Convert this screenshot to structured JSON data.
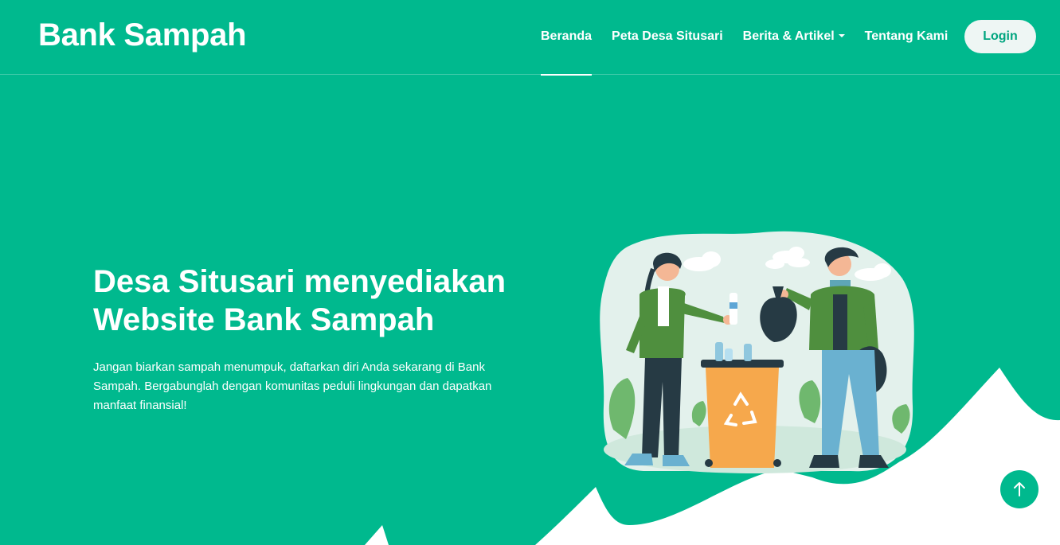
{
  "header": {
    "brand": "Bank Sampah",
    "nav": [
      {
        "label": "Beranda",
        "active": true
      },
      {
        "label": "Peta Desa Situsari"
      },
      {
        "label": "Berita & Artikel",
        "dropdown": true
      },
      {
        "label": "Tentang Kami"
      }
    ],
    "login_label": "Login"
  },
  "hero": {
    "title_line1": "Desa Situsari menyediakan",
    "title_line2": "Website Bank Sampah",
    "description": "Jangan biarkan sampah menumpuk, daftarkan diri Anda sekarang di Bank Sampah. Bergabunglah dengan komunitas peduli lingkungan dan dapatkan manfaat finansial!"
  },
  "illustration": {
    "name": "recycling-people-illustration",
    "bin_icon": "recycle-icon"
  },
  "scroll_top": {
    "icon": "arrow-up-icon"
  },
  "colors": {
    "primary": "#00b98e",
    "background_wave": "#ffffff",
    "login_bg": "#eef6f4",
    "login_text": "#00a57f"
  }
}
